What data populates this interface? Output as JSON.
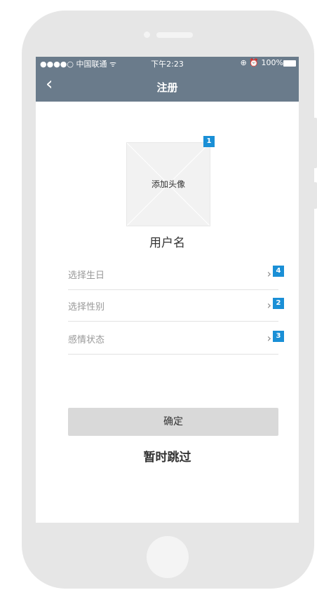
{
  "status_bar": {
    "carrier": "●●●●○ 中国联通 ᯤ",
    "time": "下午2:23",
    "right": "⊕ ⏰ 100%"
  },
  "navbar": {
    "back_icon": "‹",
    "title": "注册"
  },
  "avatar": {
    "label": "添加头像",
    "badge": "1"
  },
  "username": "用户名",
  "form": {
    "rows": [
      {
        "label": "选择生日",
        "badge": "4"
      },
      {
        "label": "选择性别",
        "badge": "2"
      },
      {
        "label": "感情状态",
        "badge": "3"
      }
    ],
    "chevron": "›"
  },
  "confirm_label": "确定",
  "skip_label": "暂时跳过",
  "colors": {
    "nav": "#6a7b8b",
    "badge": "#1a8fd6",
    "button": "#d9d9d9",
    "frame": "#e6e6e6"
  }
}
